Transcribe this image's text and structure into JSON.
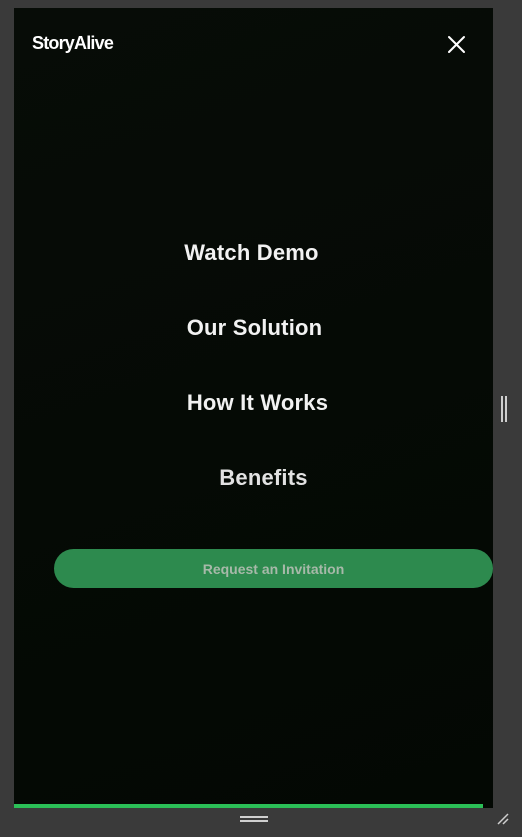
{
  "header": {
    "logo_text": "StoryAlive",
    "close_icon": "close-icon"
  },
  "menu": {
    "items": [
      {
        "label": "Watch Demo"
      },
      {
        "label": "Our Solution"
      },
      {
        "label": "How It Works"
      },
      {
        "label": "Benefits"
      }
    ],
    "cta_label": "Request an Invitation"
  },
  "colors": {
    "background": "#050a05",
    "accent": "#2d8a4e",
    "progress": "#2bbf57",
    "text": "#f2f2f2"
  }
}
